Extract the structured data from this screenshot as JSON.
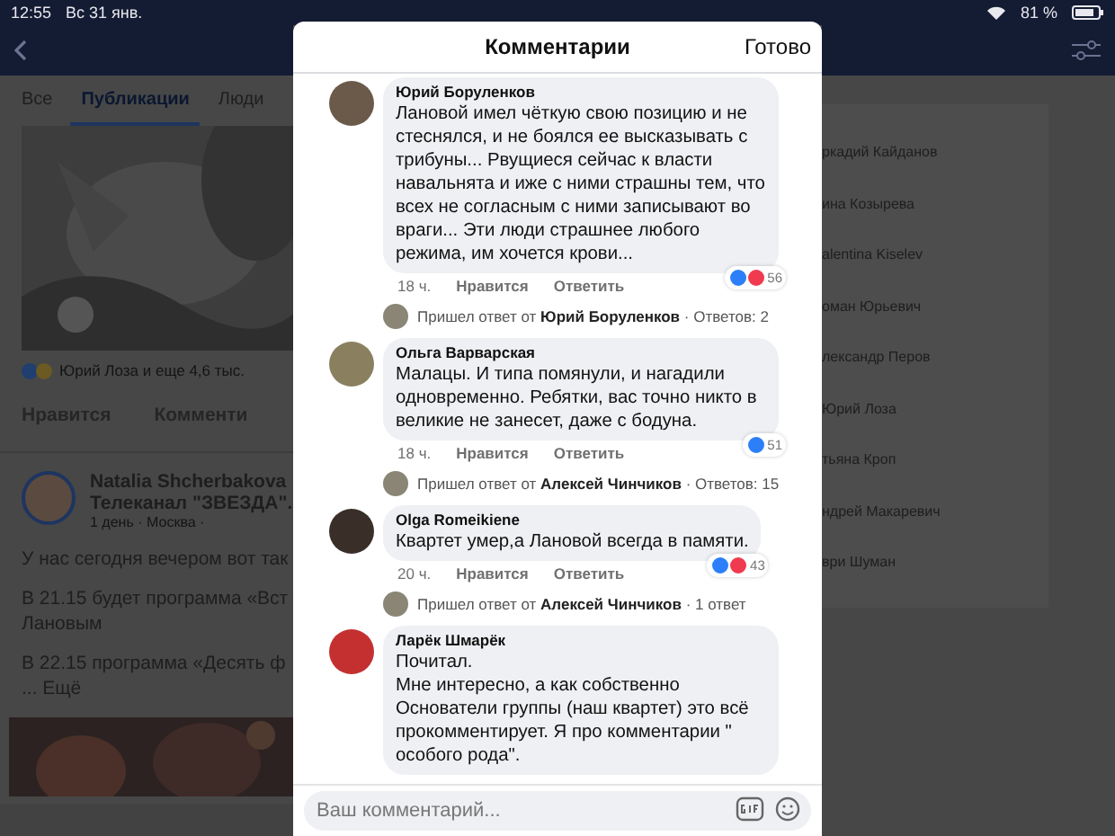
{
  "status_bar": {
    "time": "12:55",
    "date": "Вс 31 янв.",
    "battery": "81 %"
  },
  "background": {
    "tabs": [
      {
        "label": "Все",
        "selected": false
      },
      {
        "label": "Публикации",
        "selected": true
      },
      {
        "label": "Люди",
        "selected": false
      }
    ],
    "reactions_text": "Юрий Лоза и еще 4,6 тыс.",
    "actions": [
      "Нравится",
      "Комменти"
    ],
    "post": {
      "author": "Natalia Shcherbakova",
      "subtitle": "Телеканал \"ЗВЕЗДА\".",
      "meta": "1 день · Москва ·",
      "paragraphs": [
        "У нас сегодня вечером вот так",
        "В 21.15 будет программа «Вст\nЛановым",
        "В 22.15 программа «Десять ф\n... Ещё"
      ]
    },
    "people": [
      "ркадий Кайданов",
      "ина Козырева",
      "alentina Kiselev",
      "оман Юрьевич",
      "лександр Перов",
      "Юрий Лоза",
      "тьяна Кроп",
      "ндрей Макаревич",
      "ври Шуман"
    ]
  },
  "modal": {
    "title": "Комментарии",
    "done": "Готово",
    "comments": [
      {
        "author": "Юрий Боруленков",
        "text": "Лановой имел чёткую свою позицию и не стеснялся, и не боялся ее высказывать с трибуны... Рвущиеся сейчас к власти навальнята и иже с ними страшны тем, что всех не согласным с ними записывают во враги... Эти люди страшнее любого режима, им хочется крови...",
        "time": "18 ч.",
        "like": "Нравится",
        "reply": "Ответить",
        "love": true,
        "count": "56",
        "replies": {
          "prefix": "Пришел ответ от",
          "author": "Юрий Боруленков",
          "count": "· Ответов: 2"
        }
      },
      {
        "author": "Ольга Варварская",
        "text": "Малацы. И типа помянули, и нагадили одновременно. Ребятки, вас точно никто в великие не занесет, даже с бодуна.",
        "time": "18 ч.",
        "like": "Нравится",
        "reply": "Ответить",
        "love": false,
        "count": "51",
        "replies": {
          "prefix": "Пришел ответ от",
          "author": "Алексей Чинчиков",
          "count": "· Ответов: 15"
        }
      },
      {
        "author": "Olga Romeikiene",
        "text": "Квартет умер,а Лановой всегда в памяти.",
        "time": "20 ч.",
        "like": "Нравится",
        "reply": "Ответить",
        "love": true,
        "count": "43",
        "replies": {
          "prefix": "Пришел ответ от",
          "author": "Алексей Чинчиков",
          "count": "· 1 ответ"
        }
      },
      {
        "author": "Ларёк Шмарёк",
        "text": "Почитал.\nМне интересно, а как собственно Основатели группы (наш квартет) это всё прокомментирует. Я про комментарии  \" особого рода\"."
      }
    ],
    "input": {
      "placeholder": "Ваш комментарий..."
    }
  }
}
